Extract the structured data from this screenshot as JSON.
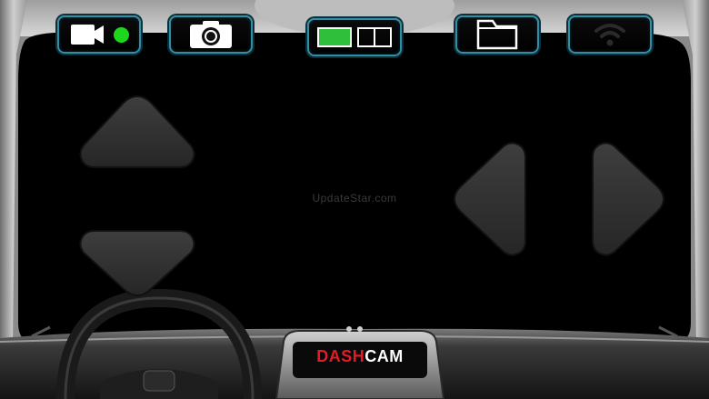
{
  "watermark": "UpdateStar.com",
  "brand": {
    "part1": "DASH",
    "part2": "CAM"
  },
  "colors": {
    "accent_border": "#2f8fa6",
    "record_dot": "#1ed61e",
    "brand_red": "#e41b23",
    "brand_white": "#ffffff"
  },
  "icons": {
    "video": "video-camera-icon",
    "photo": "photo-camera-icon",
    "layout": "split-view-icon",
    "folder": "folder-icon",
    "wifi": "wifi-icon"
  }
}
